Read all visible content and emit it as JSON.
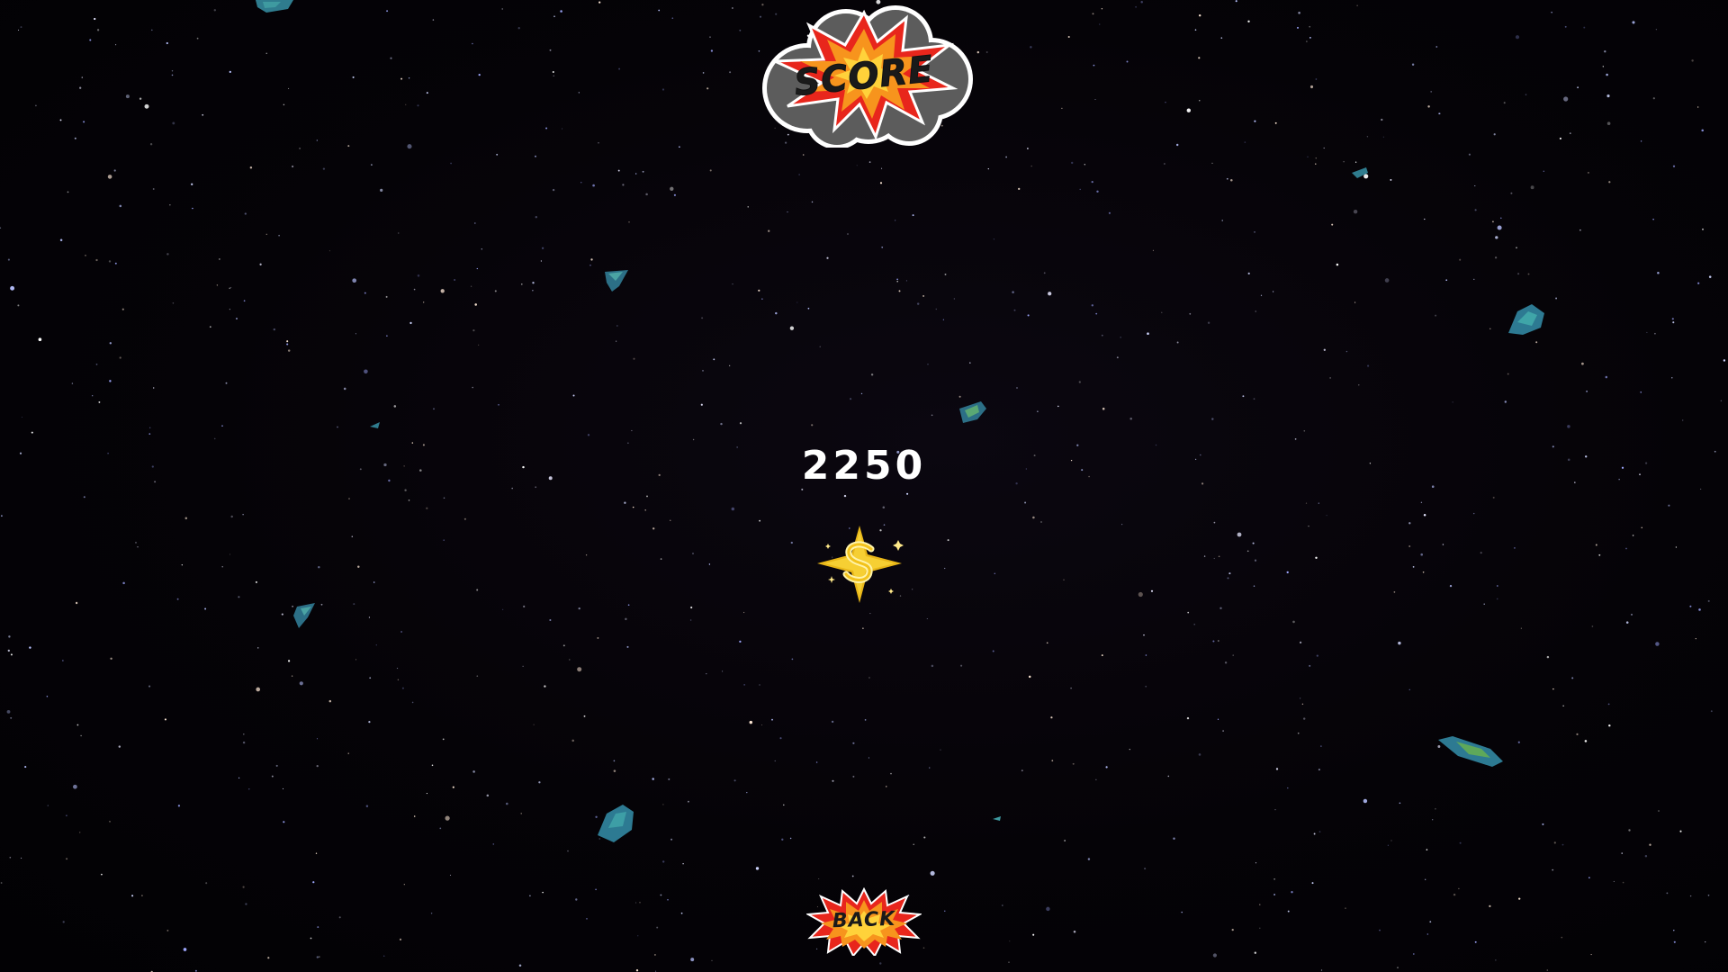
{
  "screen": {
    "name": "score-screen"
  },
  "header": {
    "title": "SCORE"
  },
  "score": {
    "value": "2250"
  },
  "coin": {
    "icon": "dollar-star-icon"
  },
  "footer": {
    "back_label": "BACK"
  },
  "colors": {
    "background": "#050307",
    "burst_red": "#e8261c",
    "burst_orange": "#f7941d",
    "cloud_grey": "#5a5a5a",
    "coin_gold": "#f2c21b",
    "asteroid_teal": "#2f7c8e",
    "text_white": "#ffffff"
  }
}
